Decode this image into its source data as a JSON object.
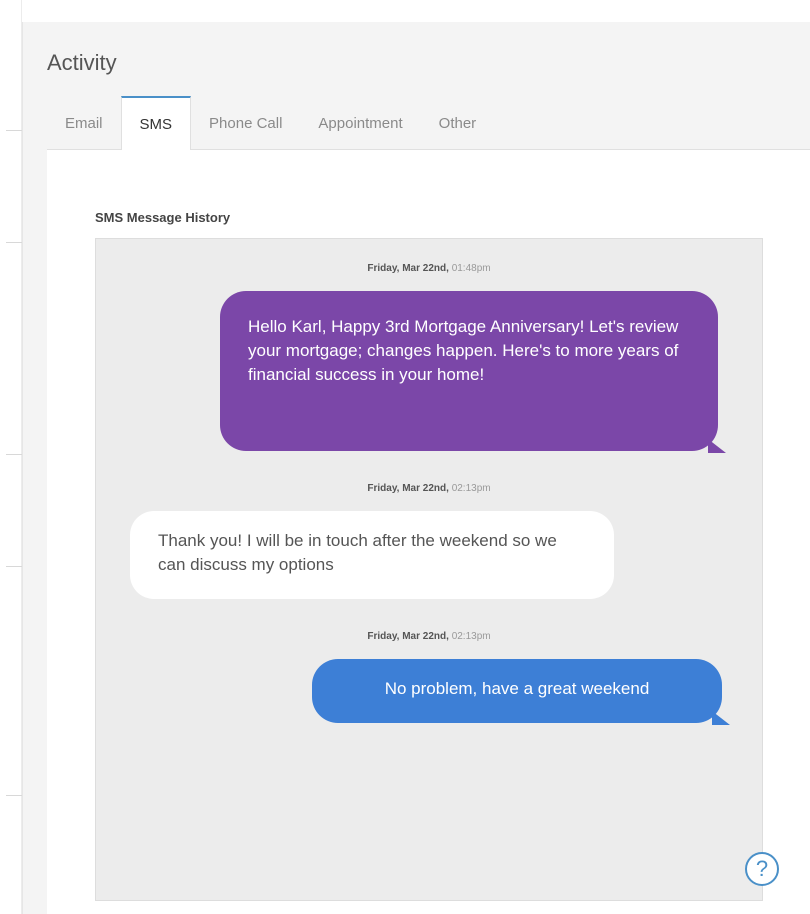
{
  "panel": {
    "title": "Activity"
  },
  "tabs": [
    {
      "label": "Email",
      "active": false
    },
    {
      "label": "SMS",
      "active": true
    },
    {
      "label": "Phone Call",
      "active": false
    },
    {
      "label": "Appointment",
      "active": false
    },
    {
      "label": "Other",
      "active": false
    }
  ],
  "sms": {
    "history_label": "SMS Message History",
    "messages": [
      {
        "direction": "outgoing",
        "color": "#7b47a8",
        "date": "Friday, Mar 22nd,",
        "time": "01:48pm",
        "text": "Hello Karl, Happy 3rd Mortgage Anniversary! Let's review your mortgage; changes happen. Here's to more years of financial success in your home!"
      },
      {
        "direction": "incoming",
        "color": "#ffffff",
        "date": "Friday, Mar 22nd,",
        "time": "02:13pm",
        "text": "Thank you! I will be in touch after the weekend so we can discuss my options"
      },
      {
        "direction": "outgoing",
        "color": "#3d7fd6",
        "date": "Friday, Mar 22nd,",
        "time": "02:13pm",
        "text": "No problem, have a great weekend"
      }
    ]
  },
  "help": {
    "icon": "help-icon",
    "label": "?"
  },
  "colors": {
    "accent": "#4a90c8",
    "purple_bubble": "#7b47a8",
    "blue_bubble": "#3d7fd6"
  }
}
